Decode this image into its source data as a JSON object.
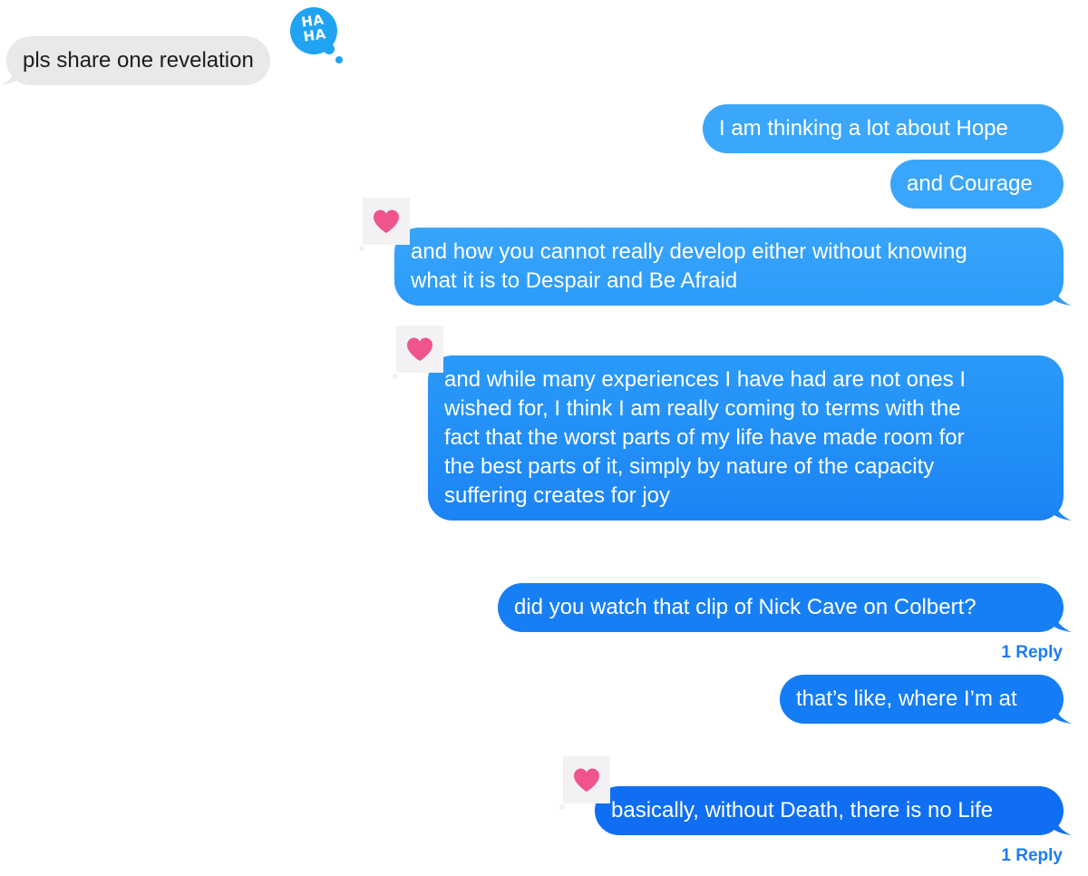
{
  "conversation": {
    "messages": [
      {
        "direction": "incoming",
        "text": "pls share one revelation",
        "reaction": "haha"
      },
      {
        "direction": "outgoing",
        "text": "I am thinking a lot about Hope"
      },
      {
        "direction": "outgoing",
        "text": "and Courage"
      },
      {
        "direction": "outgoing",
        "lines": [
          "and how you cannot really develop either without knowing",
          "what it is to Despair and Be Afraid"
        ],
        "reaction": "heart"
      },
      {
        "direction": "outgoing",
        "lines": [
          "and while many experiences I have had are not ones I",
          "wished for, I think I am really coming to terms with the",
          "fact that the worst parts of my life have made room for",
          "the best parts of it, simply by nature of the capacity",
          "suffering creates for joy"
        ],
        "reaction": "heart"
      },
      {
        "direction": "outgoing",
        "text": "did you watch that clip of Nick Cave on Colbert?",
        "reply_count": "1 Reply"
      },
      {
        "direction": "outgoing",
        "text": "that’s like, where I’m at"
      },
      {
        "direction": "outgoing",
        "text": "basically, without Death, there is no Life",
        "reaction": "heart",
        "reply_count": "1 Reply"
      }
    ],
    "reactions": {
      "haha_label": "HA\nHA"
    }
  },
  "colors": {
    "incoming_bubble": "#e9e9eb",
    "outgoing_gradient_top": "#3ba7fb",
    "outgoing_gradient_bottom": "#0f6ef2",
    "heart": "#f0548f",
    "haha_badge": "#1fa3f2",
    "reply_link": "#1a7cf5"
  }
}
